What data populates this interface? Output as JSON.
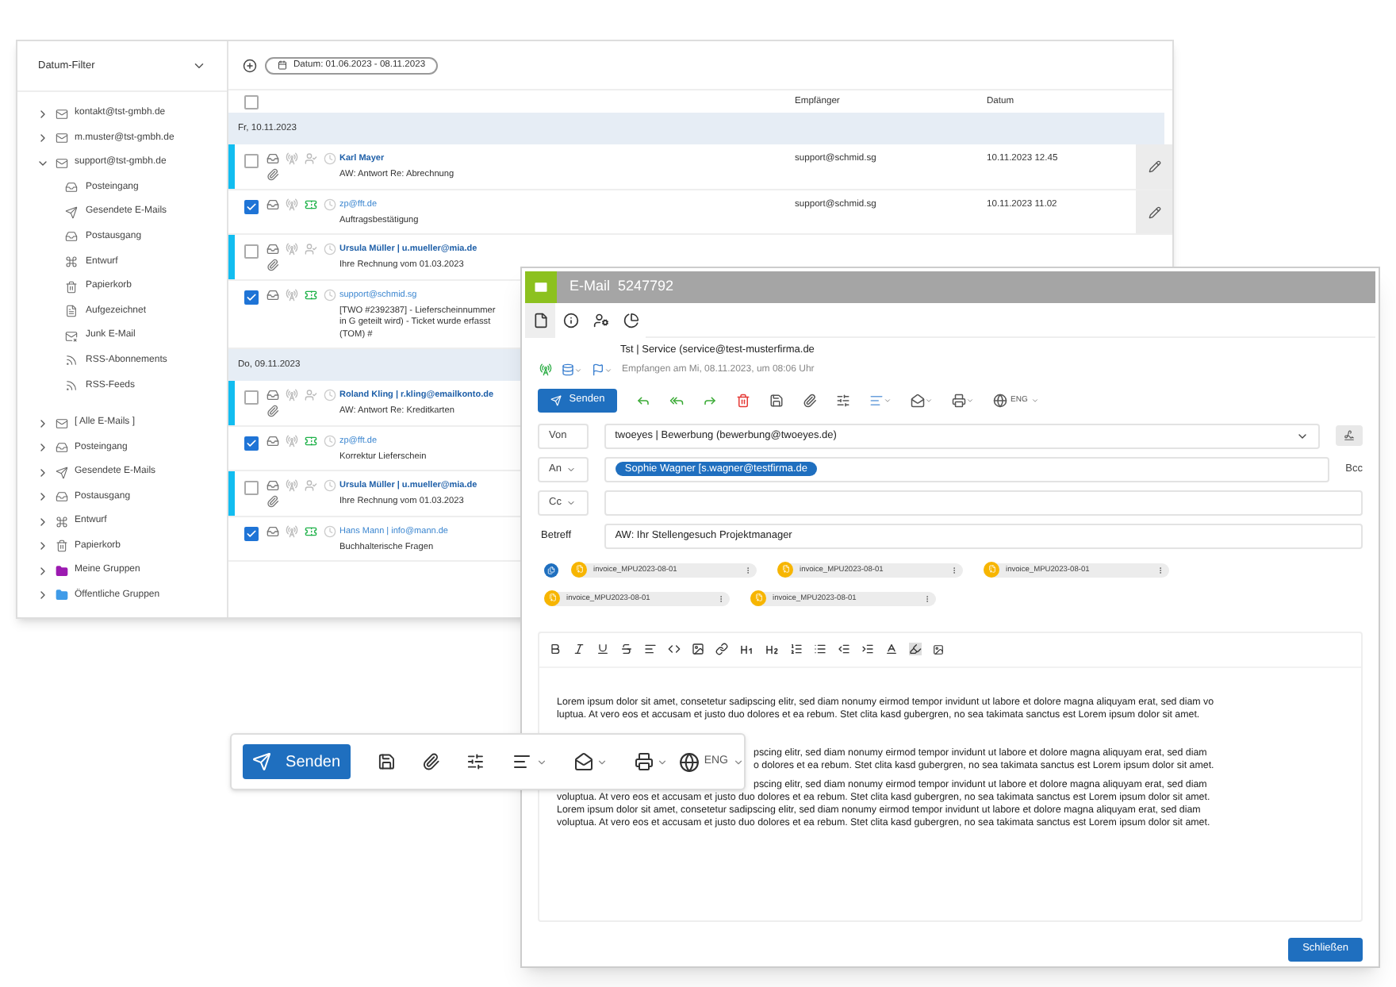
{
  "sidebar": {
    "title": "Datum-Filter",
    "accounts": [
      {
        "label": "kontakt@tst-gmbh.de",
        "kind": "account",
        "expanded": false
      },
      {
        "label": "m.muster@tst-gmbh.de",
        "kind": "account",
        "expanded": false
      },
      {
        "label": "support@tst-gmbh.de",
        "kind": "account",
        "expanded": true,
        "children": [
          {
            "label": "Posteingang",
            "kind": "inbox"
          },
          {
            "label": "Gesendete E-Mails",
            "kind": "sent"
          },
          {
            "label": "Postausgang",
            "kind": "outbox"
          },
          {
            "label": "Entwurf",
            "kind": "draft"
          },
          {
            "label": "Papierkorb",
            "kind": "trash"
          },
          {
            "label": "Aufgezeichnet",
            "kind": "recorded"
          },
          {
            "label": "Junk E-Mail",
            "kind": "junk"
          },
          {
            "label": "RSS-Abonnements",
            "kind": "rss"
          },
          {
            "label": "RSS-Feeds",
            "kind": "rss"
          }
        ]
      }
    ],
    "folders": [
      {
        "label": "[ Alle E-Mails ]",
        "kind": "account",
        "expanded": false
      },
      {
        "label": "Posteingang",
        "kind": "inbox",
        "expanded": false
      },
      {
        "label": "Gesendete E-Mails",
        "kind": "sent",
        "expanded": false
      },
      {
        "label": "Postausgang",
        "kind": "outbox",
        "expanded": false
      },
      {
        "label": "Entwurf",
        "kind": "draft",
        "expanded": false
      },
      {
        "label": "Papierkorb",
        "kind": "trash",
        "expanded": false
      },
      {
        "label": "Meine Gruppen",
        "kind": "group",
        "expanded": false,
        "color": "#9c1ab1"
      },
      {
        "label": "Öffentliche Gruppen",
        "kind": "group",
        "expanded": false,
        "color": "#3f9be8"
      }
    ]
  },
  "filter": {
    "date_range": "Datum: 01.06.2023 - 08.11.2023"
  },
  "mail_list": {
    "select_all": {
      "checked": false
    },
    "columns": [
      "Empfänger",
      "Datum"
    ],
    "groups": [
      {
        "date": "Fr, 10.11.2023",
        "rows": [
          {
            "unread": true,
            "selected": false,
            "attachment": true,
            "assigned": false,
            "sender": "Karl Mayer",
            "subject": "AW: Antwort Re: Abrechnung",
            "recipient": "support@schmid.sg",
            "date": "10.11.2023 12.45",
            "edit_button": true
          },
          {
            "unread": false,
            "selected": true,
            "attachment": false,
            "assigned": true,
            "sender": "zp@fft.de",
            "subject": "Auftragsbestätigung",
            "recipient": "support@schmid.sg",
            "date": "10.11.2023 11.02",
            "edit_button": true
          },
          {
            "unread": true,
            "selected": false,
            "attachment": true,
            "assigned": false,
            "sender": "Ursula Müller | u.mueller@mia.de",
            "subject": "Ihre Rechnung vom 01.03.2023"
          },
          {
            "unread": false,
            "selected": true,
            "attachment": false,
            "assigned": true,
            "sender": "support@schmid.sg",
            "subject": "[TWO #2392387] - Lieferscheinnummer in G geteilt wird) - Ticket wurde erfasst (TOM) #"
          }
        ]
      },
      {
        "date": "Do, 09.11.2023",
        "rows": [
          {
            "unread": true,
            "selected": false,
            "attachment": true,
            "assigned": false,
            "sender": "Roland Kling | r.kling@emailkonto.de",
            "subject": "AW: Antwort Re: Kreditkarten"
          },
          {
            "unread": false,
            "selected": true,
            "attachment": false,
            "assigned": true,
            "sender": "zp@fft.de",
            "subject": "Korrektur Lieferschein"
          },
          {
            "unread": true,
            "selected": false,
            "attachment": true,
            "assigned": false,
            "sender": "Ursula Müller | u.mueller@mia.de",
            "subject": "Ihre Rechnung vom 01.03.2023"
          },
          {
            "unread": false,
            "selected": true,
            "attachment": false,
            "assigned": true,
            "sender": "Hans Mann | info@mann.de",
            "subject": "Buchhalterische Fragen"
          }
        ]
      }
    ]
  },
  "compose": {
    "title": "E-Mail",
    "number": "5247792",
    "tabs": [
      {
        "kind": "document",
        "selected": true
      },
      {
        "kind": "info",
        "selected": false
      },
      {
        "kind": "contact",
        "selected": false
      },
      {
        "kind": "chart",
        "selected": false
      }
    ],
    "sender_line": "Tst | Service (service@test-musterfirma.de",
    "received": "Empfangen am Mi, 08.11.2023, um 08:06 Uhr",
    "send_label": "Senden",
    "language": "ENG",
    "fields": [
      {
        "kind": "select",
        "label": "Von",
        "value": "twoeyes | Bewerbung (bewerbung@twoeyes.de)"
      },
      {
        "kind": "recipients",
        "label": "An",
        "chips": [
          "Sophie Wagner [s.wagner@testfirma.de"
        ],
        "extra": "Bcc"
      },
      {
        "kind": "recipients",
        "label": "Cc"
      },
      {
        "kind": "text",
        "label": "Betreff",
        "value": "AW: Ihr Stellengesuch Projektmanager"
      }
    ],
    "attachments": [
      {
        "name": "invoice_MPU2023-08-01"
      },
      {
        "name": "invoice_MPU2023-08-01"
      },
      {
        "name": "invoice_MPU2023-08-01"
      },
      {
        "name": "invoice_MPU2023-08-01"
      },
      {
        "name": "invoice_MPU2023-08-01"
      }
    ],
    "body": [
      {
        "lines": [
          {
            "text": "Lorem ipsum dolor sit amet, consetetur sadipscing elitr, sed diam nonumy eirmod tempor invidunt ut labore et dolore magna aliquyam erat, sed diam vo",
            "covered": false
          },
          {
            "text": "luptua. At vero eos et accusam et justo duo dolores et ea rebum. Stet clita kasd gubergren, no sea takimata sanctus est Lorem ipsum dolor sit amet.",
            "covered": false
          }
        ]
      },
      {
        "lines": [
          {
            "text": "pscing elitr, sed diam nonumy eirmod tempor invidunt ut labore et dolore magna aliquyam erat, sed diam",
            "covered": true
          },
          {
            "text": "o dolores et ea rebum. Stet clita kasd gubergren, no sea takimata sanctus est Lorem ipsum dolor sit amet.",
            "covered": true
          }
        ]
      },
      {
        "lines": [
          {
            "text": "pscing elitr, sed diam nonumy eirmod tempor invidunt ut labore et dolore magna aliquyam erat, sed diam",
            "covered": true
          },
          {
            "text": "voluptua. At vero eos et accusam et justo duo dolores et ea rebum. Stet clita kasd gubergren, no sea takimata sanctus est Lorem ipsum dolor sit amet.",
            "covered": false
          },
          {
            "text": "Lorem ipsum dolor sit amet, consetetur sadipscing elitr, sed diam nonumy eirmod tempor invidunt ut labore et dolore magna aliquyam erat, sed diam",
            "covered": false
          },
          {
            "text": "voluptua. At vero eos et accusam et justo duo dolores et ea rebum. Stet clita kasd gubergren, no sea takimata sanctus est Lorem ipsum dolor sit amet.",
            "covered": false
          }
        ]
      }
    ],
    "close_label": "Schließen"
  },
  "floating_toolbar": {
    "send_label": "Senden",
    "language": "ENG"
  }
}
